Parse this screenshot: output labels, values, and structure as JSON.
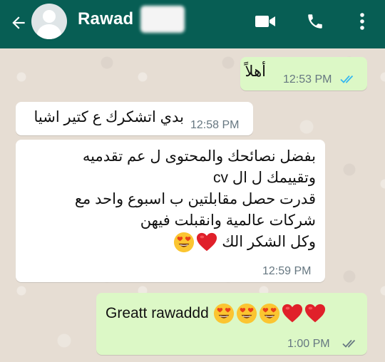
{
  "header": {
    "contact_name": "Rawad",
    "back_icon": "arrow-left-icon",
    "video_icon": "video-camera-icon",
    "phone_icon": "phone-icon",
    "menu_icon": "more-vertical-icon",
    "bar_color": "#075e54"
  },
  "messages": [
    {
      "direction": "outgoing",
      "text": "أهلاً",
      "time": "12:53 PM",
      "status": "read-double-check"
    },
    {
      "direction": "incoming",
      "text": "بدي اتشكرك ع كتير اشيا",
      "time": "12:58 PM"
    },
    {
      "direction": "incoming",
      "lines": [
        "بفضل نصائحك والمحتوى ل عم تقدميه",
        "وتقييمك ل ال cv",
        "قدرت حصل مقابلتين ب اسبوع واحد مع",
        "شركات عالمية وانقبلت فيهن",
        "وكل الشكر الك"
      ],
      "emojis": [
        "heart-eyes-emoji",
        "red-heart-emoji"
      ],
      "time": "12:59 PM"
    },
    {
      "direction": "outgoing",
      "text": "Greatt rawaddd",
      "emojis": [
        "heart-eyes-emoji",
        "heart-eyes-emoji",
        "heart-eyes-emoji",
        "red-heart-emoji",
        "red-heart-emoji"
      ],
      "time": "1:00 PM",
      "status": "delivered-double-check"
    }
  ],
  "colors": {
    "outgoing_bubble": "#dcf8c6",
    "incoming_bubble": "#ffffff",
    "read_tick": "#34b7f1",
    "delivered_tick": "#667781"
  }
}
